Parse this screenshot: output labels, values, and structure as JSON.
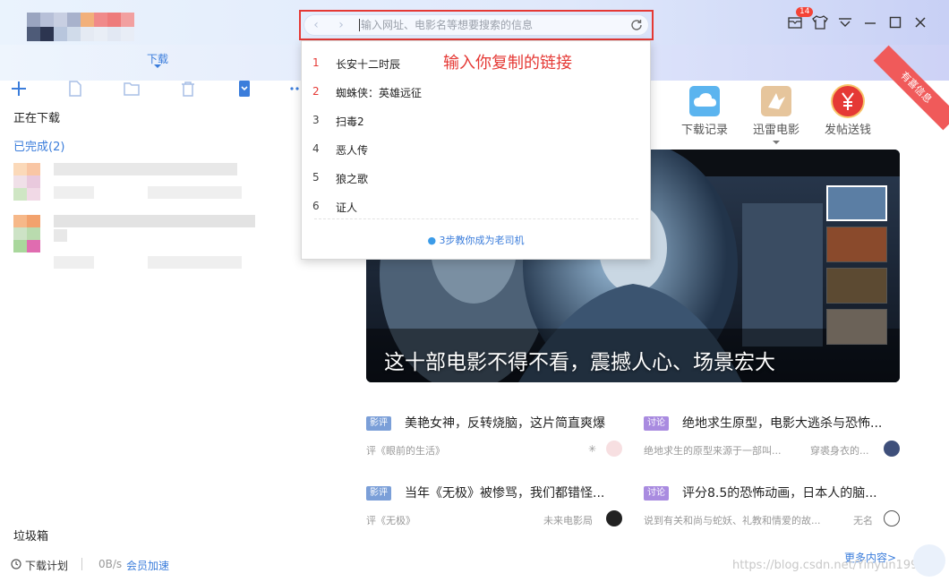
{
  "colors": {
    "accent": "#3b7ddb",
    "highlight_red": "#e53935",
    "badge_red": "#f44336",
    "ribbon_red": "#f05a5a"
  },
  "search": {
    "placeholder": "输入网址、电影名等想要搜索的信息",
    "back_icon": "chevron-left-icon",
    "forward_icon": "chevron-right-icon",
    "refresh_icon": "refresh-icon"
  },
  "window": {
    "notification_count": "14",
    "controls": [
      "message-icon",
      "skin-icon",
      "menu-icon",
      "minimize-icon",
      "maximize-icon",
      "close-icon"
    ]
  },
  "sidebar": {
    "tab_label": "下载",
    "toolbar_icons": [
      "plus-icon",
      "new-file-icon",
      "folder-icon",
      "delete-icon",
      "phone-icon",
      "more-icon"
    ],
    "downloading": "正在下载",
    "completed": "已完成(2)",
    "trash": "垃圾箱"
  },
  "statusbar": {
    "plan": "下载计划",
    "speed": "0B/s",
    "vip": "会员加速"
  },
  "dropdown": {
    "annotation": "输入你复制的链接",
    "items": [
      {
        "rank": "1",
        "title": "长安十二时辰"
      },
      {
        "rank": "2",
        "title": "蜘蛛侠：英雄远征"
      },
      {
        "rank": "3",
        "title": "扫毒2"
      },
      {
        "rank": "4",
        "title": "恶人传"
      },
      {
        "rank": "5",
        "title": "狼之歌"
      },
      {
        "rank": "6",
        "title": "证人"
      }
    ],
    "tip": "3步教你成为老司机"
  },
  "quick_links": [
    {
      "label": "下载记录",
      "icon": "cloud-icon"
    },
    {
      "label": "迅雷电影",
      "icon": "movie-bird-icon"
    },
    {
      "label": "发帖送钱",
      "icon": "yuan-icon"
    }
  ],
  "ribbon": "有喜信息",
  "banner": {
    "caption": "这十部电影不得不看，震撼人心、场景宏大"
  },
  "cards": [
    {
      "tag": "影评",
      "title": "美艳女神，反转烧脑，这片简直爽爆",
      "sub": "评《眼前的生活》",
      "author": ""
    },
    {
      "tag": "讨论",
      "title": "绝地求生原型，电影大逃杀与恐怖...",
      "sub": "绝地求生的原型来源于一部叫...",
      "author": "穿裘身衣的..."
    },
    {
      "tag": "影评",
      "title": "当年《无极》被惨骂，我们都错怪...",
      "sub": "评《无极》",
      "author": "未来电影局"
    },
    {
      "tag": "讨论",
      "title": "评分8.5的恐怖动画，日本人的脑...",
      "sub": "说到有关和尚与蛇妖、礼教和情爱的故...",
      "author": "无名"
    }
  ],
  "more": "更多内容>",
  "watermark": "https://blog.csdn.net/Yinyun1996"
}
